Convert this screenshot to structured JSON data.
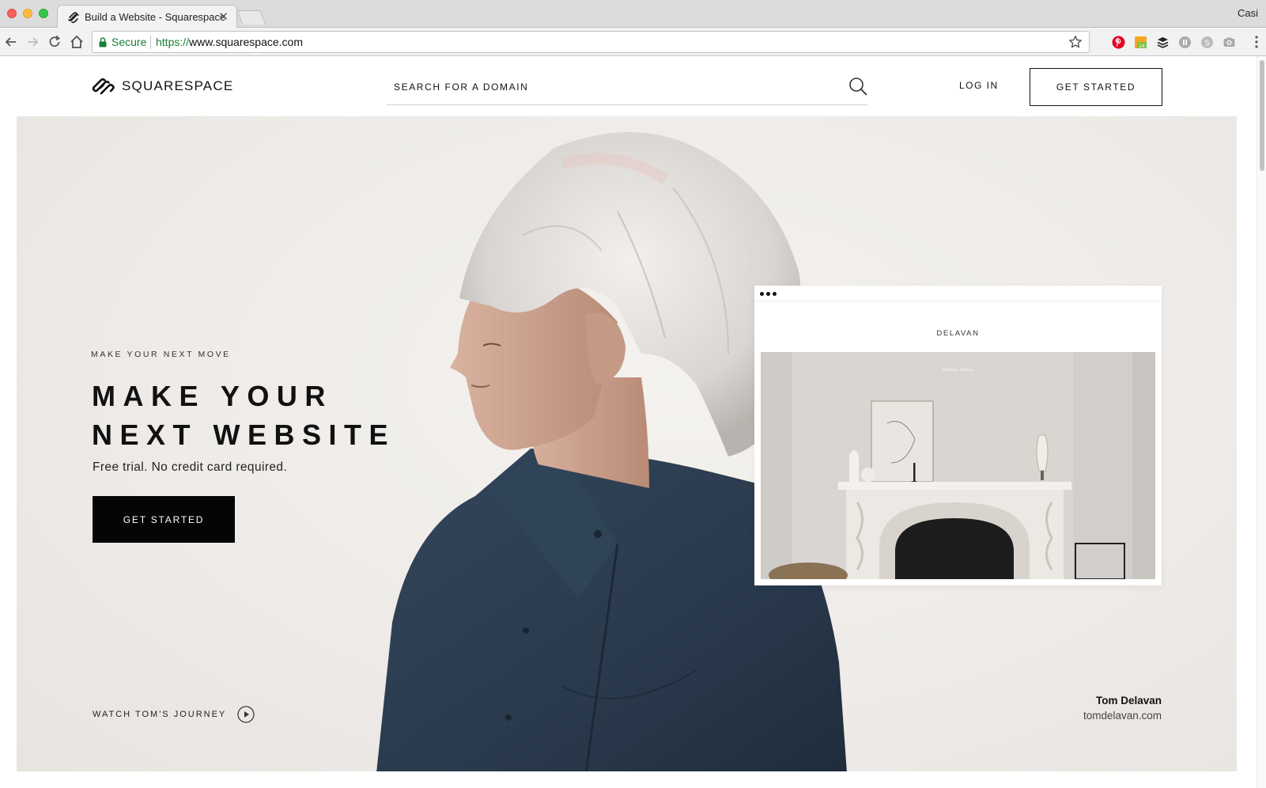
{
  "browser": {
    "tab_title": "Build a Website - Squarespace",
    "profile_name": "Casi",
    "secure_label": "Secure",
    "url_scheme": "https://",
    "url_host": "www.squarespace.com"
  },
  "header": {
    "logo_text": "SQUARESPACE",
    "domain_search_placeholder": "SEARCH FOR A DOMAIN",
    "login_label": "LOG IN",
    "get_started_label": "GET STARTED"
  },
  "hero": {
    "eyebrow": "MAKE YOUR NEXT MOVE",
    "headline_line1": "MAKE YOUR",
    "headline_line2": "NEXT WEBSITE",
    "subline": "Free trial. No credit card required.",
    "cta_label": "GET STARTED",
    "watch_label": "WATCH TOM'S JOURNEY",
    "credit_name": "Tom Delavan",
    "credit_url": "tomdelavan.com"
  },
  "mock_site": {
    "brand": "DELAVAN",
    "nav": "Home   Shop"
  },
  "colors": {
    "secure_green": "#188038",
    "button_black": "#050505",
    "hero_bg": "#eeebe8",
    "shirt_navy": "#2b3a4d"
  },
  "icons": [
    "squarespace-tab-icon",
    "back-arrow-icon",
    "forward-arrow-icon",
    "reload-icon",
    "home-icon",
    "lock-icon",
    "star-icon",
    "pinterest-icon",
    "calendar-icon",
    "buffer-icon",
    "pause-icon",
    "skype-icon",
    "camera-icon",
    "more-menu-icon",
    "squarespace-logo-icon",
    "search-icon",
    "play-icon"
  ]
}
